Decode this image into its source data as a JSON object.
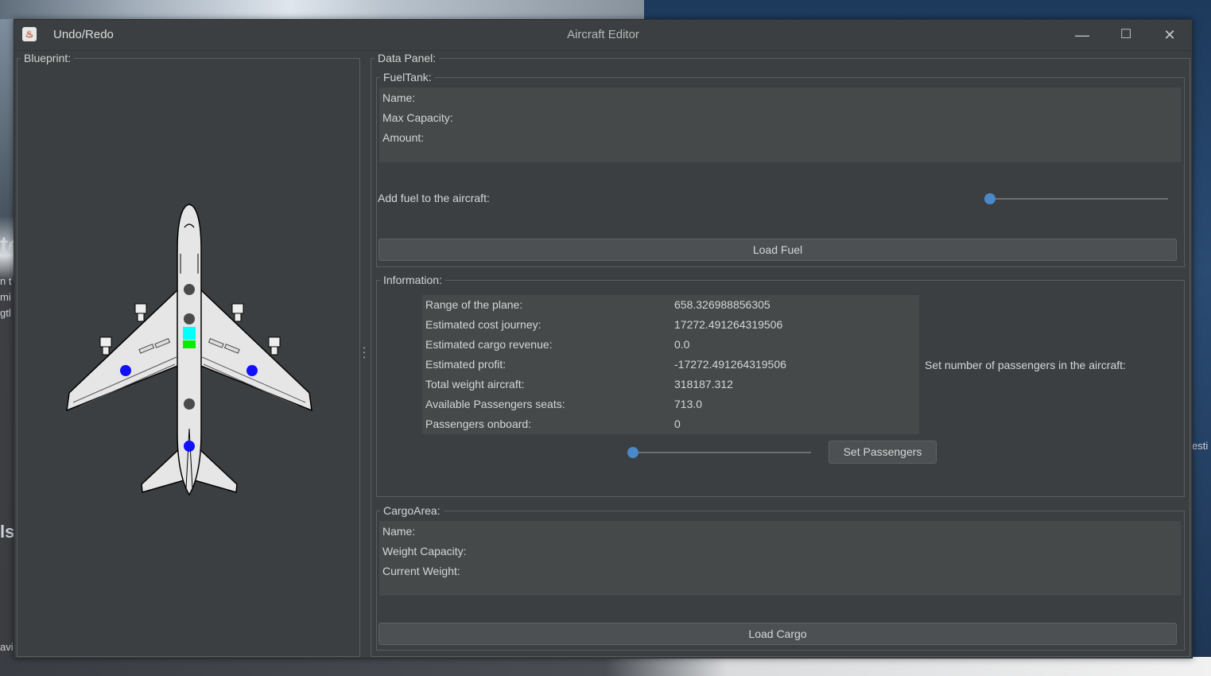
{
  "window": {
    "title": "Aircraft Editor",
    "menu_undo_redo": "Undo/Redo",
    "minimize": "—",
    "maximize": "☐",
    "close": "✕"
  },
  "blueprint": {
    "label": "Blueprint:"
  },
  "data_panel": {
    "label": "Data Panel:",
    "fuel_tank": {
      "label": "FuelTank:",
      "name_label": "Name:",
      "max_capacity_label": "Max Capacity:",
      "amount_label": "Amount:",
      "add_fuel_label": "Add fuel to the aircraft:",
      "fuel_slider_value": 0,
      "load_fuel_button": "Load Fuel"
    },
    "information": {
      "label": "Information:",
      "rows": [
        {
          "label": "Range of the plane:",
          "value": "658.326988856305"
        },
        {
          "label": "Estimated cost journey:",
          "value": "17272.491264319506"
        },
        {
          "label": "Estimated cargo revenue:",
          "value": "0.0"
        },
        {
          "label": "Estimated profit:",
          "value": "-17272.491264319506"
        },
        {
          "label": "Total weight aircraft:",
          "value": "318187.312"
        },
        {
          "label": "Available Passengers seats:",
          "value": "713.0"
        },
        {
          "label": "Passengers onboard:",
          "value": "0"
        }
      ],
      "set_passengers_label": "Set number of passengers in the aircraft:",
      "passenger_slider_value": 0,
      "set_passengers_button": "Set Passengers"
    },
    "cargo_area": {
      "label": "CargoArea:",
      "name_label": "Name:",
      "weight_capacity_label": "Weight Capacity:",
      "current_weight_label": "Current Weight:",
      "load_cargo_button": "Load Cargo"
    }
  },
  "colors": {
    "window_bg": "#3c3f41",
    "slider_thumb": "#4a88c7",
    "fuel_tank_cyan": "#00ffff",
    "fuel_tank_green": "#00ee00",
    "cargo_point_blue": "#1010ff",
    "seat_gray": "#4a4a4a"
  },
  "desktop_edge_text": [
    "te",
    "n t",
    "mi",
    "gtl",
    "ls",
    "avi",
    "esti"
  ]
}
